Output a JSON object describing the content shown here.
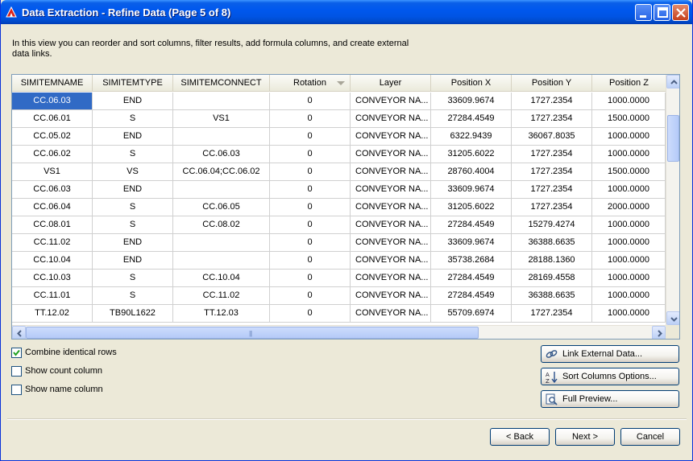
{
  "window": {
    "title": "Data Extraction - Refine Data (Page 5 of 8)"
  },
  "description": "In this view you can reorder and sort columns, filter results, add formula columns, and create external data links.",
  "grid": {
    "columns": [
      "SIMITEMNAME",
      "SIMITEMTYPE",
      "SIMITEMCONNECT",
      "Rotation",
      "Layer",
      "Position X",
      "Position Y",
      "Position Z"
    ],
    "rows": [
      [
        "CC.06.03",
        "END",
        "",
        "0",
        "CONVEYOR NA...",
        "33609.9674",
        "1727.2354",
        "1000.0000"
      ],
      [
        "CC.06.01",
        "S",
        "VS1",
        "0",
        "CONVEYOR NA...",
        "27284.4549",
        "1727.2354",
        "1500.0000"
      ],
      [
        "CC.05.02",
        "END",
        "",
        "0",
        "CONVEYOR NA...",
        "6322.9439",
        "36067.8035",
        "1000.0000"
      ],
      [
        "CC.06.02",
        "S",
        "CC.06.03",
        "0",
        "CONVEYOR NA...",
        "31205.6022",
        "1727.2354",
        "1000.0000"
      ],
      [
        "VS1",
        "VS",
        "CC.06.04;CC.06.02",
        "0",
        "CONVEYOR NA...",
        "28760.4004",
        "1727.2354",
        "1500.0000"
      ],
      [
        "CC.06.03",
        "END",
        "",
        "0",
        "CONVEYOR NA...",
        "33609.9674",
        "1727.2354",
        "1000.0000"
      ],
      [
        "CC.06.04",
        "S",
        "CC.06.05",
        "0",
        "CONVEYOR NA...",
        "31205.6022",
        "1727.2354",
        "2000.0000"
      ],
      [
        "CC.08.01",
        "S",
        "CC.08.02",
        "0",
        "CONVEYOR NA...",
        "27284.4549",
        "15279.4274",
        "1000.0000"
      ],
      [
        "CC.11.02",
        "END",
        "",
        "0",
        "CONVEYOR NA...",
        "33609.9674",
        "36388.6635",
        "1000.0000"
      ],
      [
        "CC.10.04",
        "END",
        "",
        "0",
        "CONVEYOR NA...",
        "35738.2684",
        "28188.1360",
        "1000.0000"
      ],
      [
        "CC.10.03",
        "S",
        "CC.10.04",
        "0",
        "CONVEYOR NA...",
        "27284.4549",
        "28169.4558",
        "1000.0000"
      ],
      [
        "CC.11.01",
        "S",
        "CC.11.02",
        "0",
        "CONVEYOR NA...",
        "27284.4549",
        "36388.6635",
        "1000.0000"
      ],
      [
        "TT.12.02",
        "TB90L1622",
        "TT.12.03",
        "0",
        "CONVEYOR NA...",
        "55709.6974",
        "1727.2354",
        "1000.0000"
      ]
    ],
    "selected_cell": "CC.06.03",
    "sorted_column": "Rotation"
  },
  "options": {
    "combine_identical_rows": {
      "label": "Combine identical rows",
      "checked": true
    },
    "show_count_column": {
      "label": "Show count column",
      "checked": false
    },
    "show_name_column": {
      "label": "Show name column",
      "checked": false
    }
  },
  "actions": {
    "link_external_data": "Link External Data...",
    "sort_columns_options": "Sort Columns Options...",
    "full_preview": "Full Preview..."
  },
  "footer": {
    "back": "< Back",
    "next": "Next >",
    "cancel": "Cancel"
  },
  "colors": {
    "title_bar": "#0054e3",
    "selection": "#316ac5",
    "window_bg": "#ece9d8"
  }
}
